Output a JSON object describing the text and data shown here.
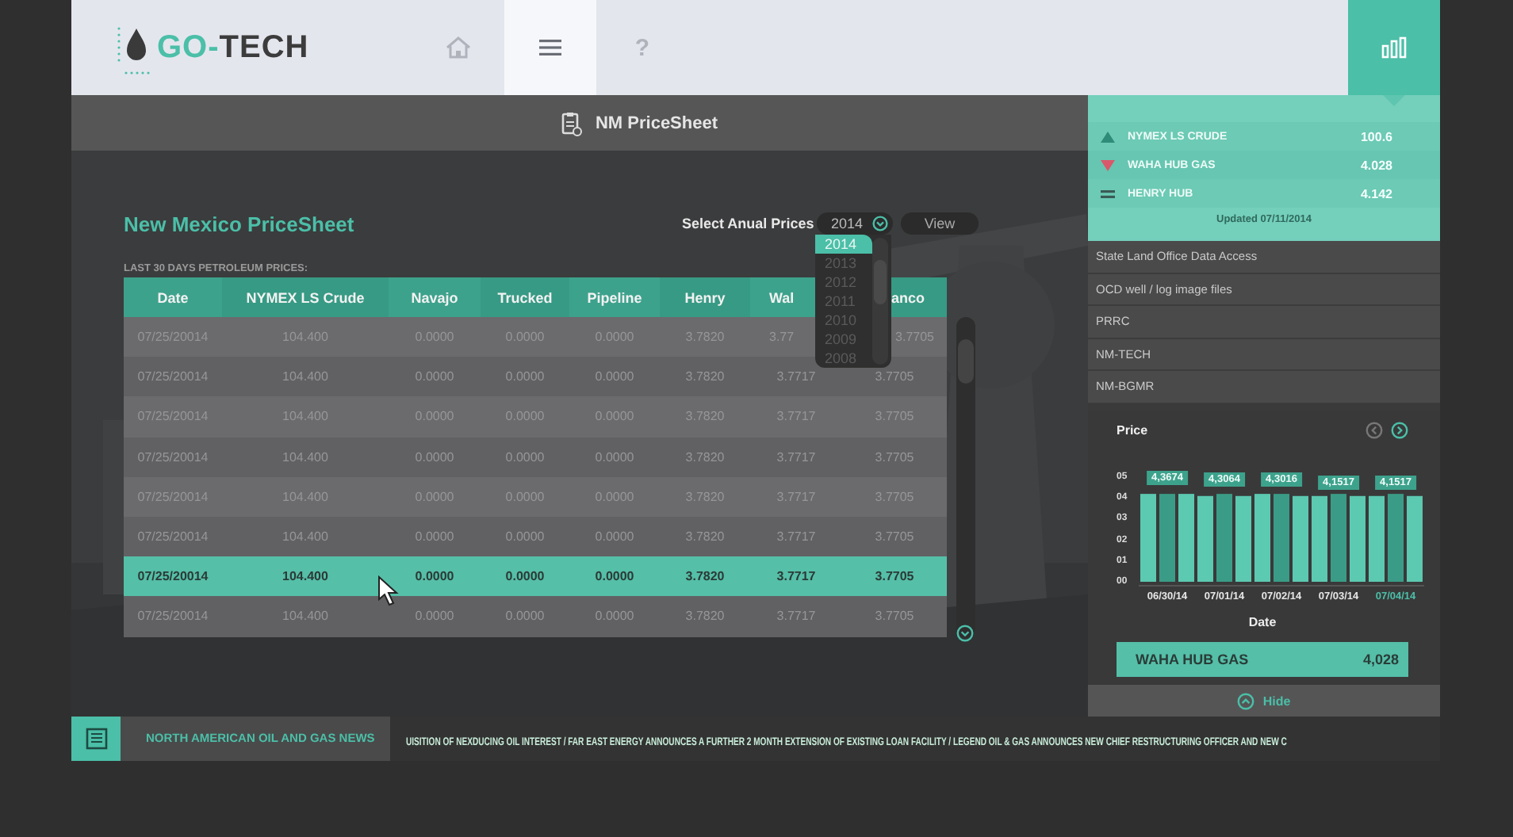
{
  "header": {
    "logo": {
      "text_a": "GO-",
      "text_b": "TECH"
    },
    "nav": [
      {
        "kind": "home",
        "selected": false
      },
      {
        "kind": "menu",
        "selected": true
      },
      {
        "kind": "help",
        "glyph": "?",
        "selected": false
      }
    ],
    "chart_button": {
      "selected": true
    }
  },
  "page_title": "NM PriceSheet",
  "main": {
    "title": "New Mexico PriceSheet",
    "select_label": "Select Anual Prices",
    "year_value": "2014",
    "view_button": "View",
    "year_options": [
      {
        "label": "2014",
        "selected": true
      },
      {
        "label": "2013",
        "selected": false
      },
      {
        "label": "2012",
        "selected": false
      },
      {
        "label": "2011",
        "selected": false
      },
      {
        "label": "2010",
        "selected": false
      },
      {
        "label": "2009",
        "selected": false
      },
      {
        "label": "2008",
        "selected": false
      }
    ],
    "table_caption": "LAST 30 DAYS PETROLEUM PRICES:",
    "table": {
      "columns": [
        "Date",
        "NYMEX LS Crude",
        "Navajo",
        "Trucked",
        "Pipeline",
        "Henry",
        "Wal",
        "anco"
      ],
      "rows": [
        {
          "selected": false,
          "cells": [
            "07/25/20014",
            "104.400",
            "0.0000",
            "0.0000",
            "0.0000",
            "3.7820",
            "3.77",
            "3.7705"
          ]
        },
        {
          "selected": false,
          "cells": [
            "07/25/20014",
            "104.400",
            "0.0000",
            "0.0000",
            "0.0000",
            "3.7820",
            "3.7717",
            "3.7705"
          ]
        },
        {
          "selected": false,
          "cells": [
            "07/25/20014",
            "104.400",
            "0.0000",
            "0.0000",
            "0.0000",
            "3.7820",
            "3.7717",
            "3.7705"
          ]
        },
        {
          "selected": false,
          "cells": [
            "07/25/20014",
            "104.400",
            "0.0000",
            "0.0000",
            "0.0000",
            "3.7820",
            "3.7717",
            "3.7705"
          ]
        },
        {
          "selected": false,
          "cells": [
            "07/25/20014",
            "104.400",
            "0.0000",
            "0.0000",
            "0.0000",
            "3.7820",
            "3.7717",
            "3.7705"
          ]
        },
        {
          "selected": false,
          "cells": [
            "07/25/20014",
            "104.400",
            "0.0000",
            "0.0000",
            "0.0000",
            "3.7820",
            "3.7717",
            "3.7705"
          ]
        },
        {
          "selected": true,
          "cells": [
            "07/25/20014",
            "104.400",
            "0.0000",
            "0.0000",
            "0.0000",
            "3.7820",
            "3.7717",
            "3.7705"
          ]
        },
        {
          "selected": false,
          "cells": [
            "07/25/20014",
            "104.400",
            "0.0000",
            "0.0000",
            "0.0000",
            "3.7820",
            "3.7717",
            "3.7705"
          ]
        }
      ]
    }
  },
  "sidebar": {
    "quotes": [
      {
        "kind": "up",
        "name": "NYMEX LS CRUDE",
        "value": "100.6"
      },
      {
        "kind": "down",
        "name": "WAHA HUB GAS",
        "value": "4.028"
      },
      {
        "kind": "equal",
        "name": "HENRY HUB",
        "value": "4.142"
      }
    ],
    "updated": "Updated 07/11/2014",
    "links": [
      "State Land Office Data Access",
      "OCD well / log image files",
      "PRRC",
      "NM-TECH",
      "NM-BGMR"
    ],
    "chart_panel": {
      "category_selected": [
        false,
        false,
        false,
        false,
        true
      ],
      "chart_data": {
        "type": "bar",
        "title": "Price",
        "xlabel": "Date",
        "categories": [
          "06/30/14",
          "07/01/14",
          "07/02/14",
          "07/03/14",
          "07/04/14"
        ],
        "series": [
          {
            "color": "#5cc9b1",
            "values": [
              4.2,
              4.1,
              4.2,
              4.1,
              4.1
            ]
          },
          {
            "color": "#3a9c86",
            "values": [
              4.2,
              4.2,
              4.2,
              4.2,
              4.2
            ]
          },
          {
            "color": "#5cc9b1",
            "values": [
              4.2,
              4.1,
              4.1,
              4.1,
              4.1
            ]
          }
        ],
        "ylim": [
          0,
          5
        ],
        "yticks": [
          {
            "value": 0,
            "label": "00"
          },
          {
            "value": 1,
            "label": "01"
          },
          {
            "value": 2,
            "label": "02"
          },
          {
            "value": 3,
            "label": "03"
          },
          {
            "value": 4,
            "label": "04"
          },
          {
            "value": 5,
            "label": "05"
          }
        ],
        "annotations": [
          {
            "x": "06/30/14",
            "y": 4.3674,
            "text": "4,3674"
          },
          {
            "x": "07/01/14",
            "y": 4.3064,
            "text": "4,3064"
          },
          {
            "x": "07/02/14",
            "y": 4.3016,
            "text": "4,3016"
          },
          {
            "x": "07/03/14",
            "y": 4.1517,
            "text": "4,1517"
          },
          {
            "x": "07/04/14",
            "y": 4.1517,
            "text": "4,1517"
          }
        ]
      },
      "readout": {
        "name": "WAHA HUB GAS",
        "value": "4,028"
      },
      "hide_button": "Hide"
    }
  },
  "news": {
    "title": "NORTH AMERICAN OIL AND GAS NEWS",
    "ticker": "UISITION OF NEXDUCING OIL INTEREST / FAR EAST ENERGY ANNOUNCES A FURTHER 2 MONTH EXTENSION OF EXISTING LOAN FACILITY /  LEGEND OIL & GAS ANNOUNCES NEW CHIEF RESTRUCTURING OFFICER AND NEW C"
  }
}
